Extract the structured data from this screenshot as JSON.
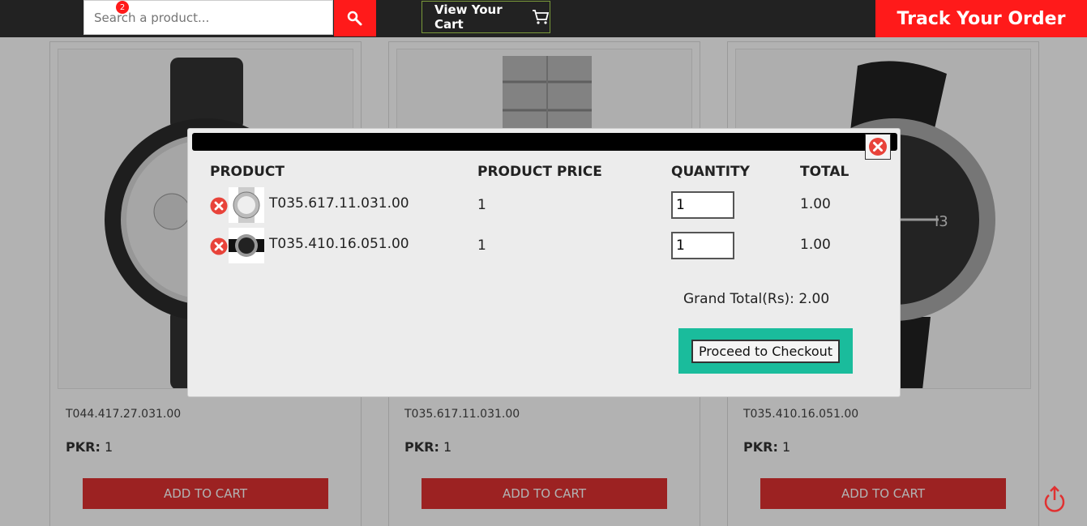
{
  "header": {
    "search_placeholder": "Search a product...",
    "view_cart_label": "View Your Cart",
    "cart_count": "2",
    "track_order_label": "Track Your Order"
  },
  "products": [
    {
      "sku": "T044.417.27.031.00",
      "price_label": "PKR:",
      "price_value": "1",
      "add_label": "ADD TO CART"
    },
    {
      "sku": "T035.617.11.031.00",
      "price_label": "PKR:",
      "price_value": "1",
      "add_label": "ADD TO CART"
    },
    {
      "sku": "T035.410.16.051.00",
      "price_label": "PKR:",
      "price_value": "1",
      "add_label": "ADD TO CART"
    }
  ],
  "cart_modal": {
    "headers": [
      "PRODUCT",
      "PRODUCT PRICE",
      "QUANTITY",
      "TOTAL"
    ],
    "items": [
      {
        "name": "T035.617.11.031.00",
        "price": "1",
        "quantity": "1",
        "total": "1.00"
      },
      {
        "name": "T035.410.16.051.00",
        "price": "1",
        "quantity": "1",
        "total": "1.00"
      }
    ],
    "grand_total_label": "Grand Total(Rs):",
    "grand_total_value": "2.00",
    "checkout_label": "Proceed to Checkout"
  },
  "colors": {
    "accent_red": "#ff1a1a",
    "header_bg": "#222222",
    "checkout_green": "#1abc9c"
  },
  "icons": [
    "search-icon",
    "cart-icon",
    "close-icon",
    "remove-item-icon",
    "scroll-top-icon"
  ]
}
